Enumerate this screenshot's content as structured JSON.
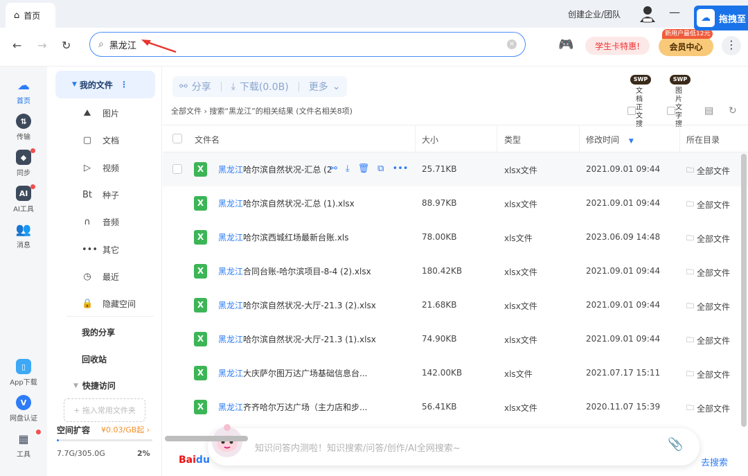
{
  "titlebar": {
    "tab_label": "首页",
    "create_team": "创建企业/团队",
    "drag_button": "拖拽至"
  },
  "nav": {
    "search_value": "黑龙江",
    "student_card": "学生卡特惠!",
    "new_user_badge": "新用户最低12元",
    "member_center": "会员中心"
  },
  "rail": [
    {
      "label": "首页",
      "icon": "cloud-icon"
    },
    {
      "label": "传输",
      "icon": "transfer-icon"
    },
    {
      "label": "同步",
      "icon": "sync-icon"
    },
    {
      "label": "AI工具",
      "icon": "ai-icon",
      "icon_text": "AI"
    },
    {
      "label": "消息",
      "icon": "message-icon"
    },
    {
      "label": "App下载",
      "icon": "app-icon"
    },
    {
      "label": "网盘认证",
      "icon": "verify-icon",
      "icon_text": "V"
    },
    {
      "label": "工具",
      "icon": "tools-icon"
    }
  ],
  "sidebar": {
    "my_docs": "我的文件",
    "categories": [
      {
        "label": "图片",
        "glyph": "⛰"
      },
      {
        "label": "文档",
        "glyph": "▢"
      },
      {
        "label": "视频",
        "glyph": "▷"
      },
      {
        "label": "种子",
        "glyph": "Bt"
      },
      {
        "label": "音频",
        "glyph": "∩"
      },
      {
        "label": "其它",
        "glyph": "•••"
      },
      {
        "label": "最近",
        "glyph": "◷"
      },
      {
        "label": "隐藏空间",
        "glyph": "🔒"
      }
    ],
    "my_share": "我的分享",
    "recycle": "回收站",
    "quick_access": "快捷访问",
    "drop_hint": "+ 拖入常用文件夹",
    "space_title": "空间扩容",
    "space_price": "¥0.03/GB起",
    "space_used": "7.7G/305.0G",
    "space_pct": "2%",
    "space_fraction": 0.02
  },
  "main": {
    "toolbar": {
      "share": "分享",
      "download": "下载(0.0B)",
      "more": "更多"
    },
    "swp1": {
      "tag": "SWP",
      "text": "文档正文搜"
    },
    "swp2": {
      "tag": "SWP",
      "text": "图片文字搜"
    },
    "breadcrumb_root": "全部文件",
    "breadcrumb_search": "搜索“黑龙江”的相关结果 (文件名相关8项)",
    "headers": {
      "name": "文件名",
      "size": "大小",
      "type": "类型",
      "modified": "修改时间",
      "dir": "所在目录"
    },
    "rows": [
      {
        "hl": "黑龙江",
        "rest": "哈尔滨自然状况-汇总 (2",
        "size": "25.71KB",
        "type": "xlsx文件",
        "date": "2021.09.01 09:44",
        "dir": "全部文件"
      },
      {
        "hl": "黑龙江",
        "rest": "哈尔滨自然状况-汇总 (1).xlsx",
        "size": "88.97KB",
        "type": "xlsx文件",
        "date": "2021.09.01 09:44",
        "dir": "全部文件"
      },
      {
        "hl": "黑龙江",
        "rest": "哈尔滨西城红场最新台账.xls",
        "size": "78.00KB",
        "type": "xls文件",
        "date": "2023.06.09 14:48",
        "dir": "全部文件"
      },
      {
        "hl": "黑龙江",
        "rest": "合同台账-哈尔滨项目-8-4 (2).xlsx",
        "size": "180.42KB",
        "type": "xlsx文件",
        "date": "2021.09.01 09:44",
        "dir": "全部文件"
      },
      {
        "hl": "黑龙江",
        "rest": "哈尔滨自然状况-大厅-21.3 (2).xlsx",
        "size": "21.68KB",
        "type": "xlsx文件",
        "date": "2021.09.01 09:44",
        "dir": "全部文件"
      },
      {
        "hl": "黑龙江",
        "rest": "哈尔滨自然状况-大厅-21.3 (1).xlsx",
        "size": "74.90KB",
        "type": "xlsx文件",
        "date": "2021.09.01 09:44",
        "dir": "全部文件"
      },
      {
        "hl": "黑龙江",
        "rest": "大庆萨尔图万达广场基础信息台...",
        "size": "142.00KB",
        "type": "xls文件",
        "date": "2021.07.17 15:11",
        "dir": "全部文件"
      },
      {
        "hl": "黑龙江",
        "rest": "齐齐哈尔万达广场（主力店和步...",
        "size": "56.41KB",
        "type": "xlsx文件",
        "date": "2020.11.07 15:39",
        "dir": "全部文件"
      }
    ]
  },
  "ai": {
    "placeholder": "知识问答内测啦！知识搜索/问答/创作/AI全网搜索~",
    "baidu_bai": "Bai",
    "baidu_du": "du",
    "search_link": "去搜索"
  },
  "colors": {
    "accent": "#2d7cf6",
    "excel_green": "#3cb556",
    "member_gold": "#f9c97a"
  }
}
